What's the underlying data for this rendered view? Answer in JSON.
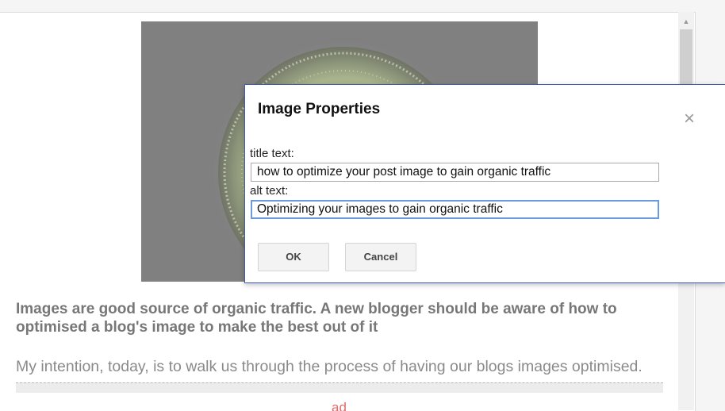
{
  "post": {
    "bold_paragraph": "Images are good source of organic traffic. A new blogger should be aware of how to optimised a blog's image to make the best out of it",
    "body_paragraph": "My intention, today, is to walk us through the process of having our blogs images optimised.",
    "ad_label": "ad"
  },
  "dialog": {
    "title": "Image Properties",
    "close_glyph": "×",
    "title_text_label": "title text:",
    "title_text_value": "how to optimize your post image to gain organic traffic",
    "alt_text_label": "alt text:",
    "alt_text_value": "Optimizing your images to gain organic traffic",
    "ok_label": "OK",
    "cancel_label": "Cancel"
  },
  "scrollbar": {
    "up_arrow_glyph": "▲"
  },
  "colors": {
    "dialog_border": "#3f5fae",
    "focus_border": "#6a9be0",
    "ad_text": "#e46a6a"
  }
}
